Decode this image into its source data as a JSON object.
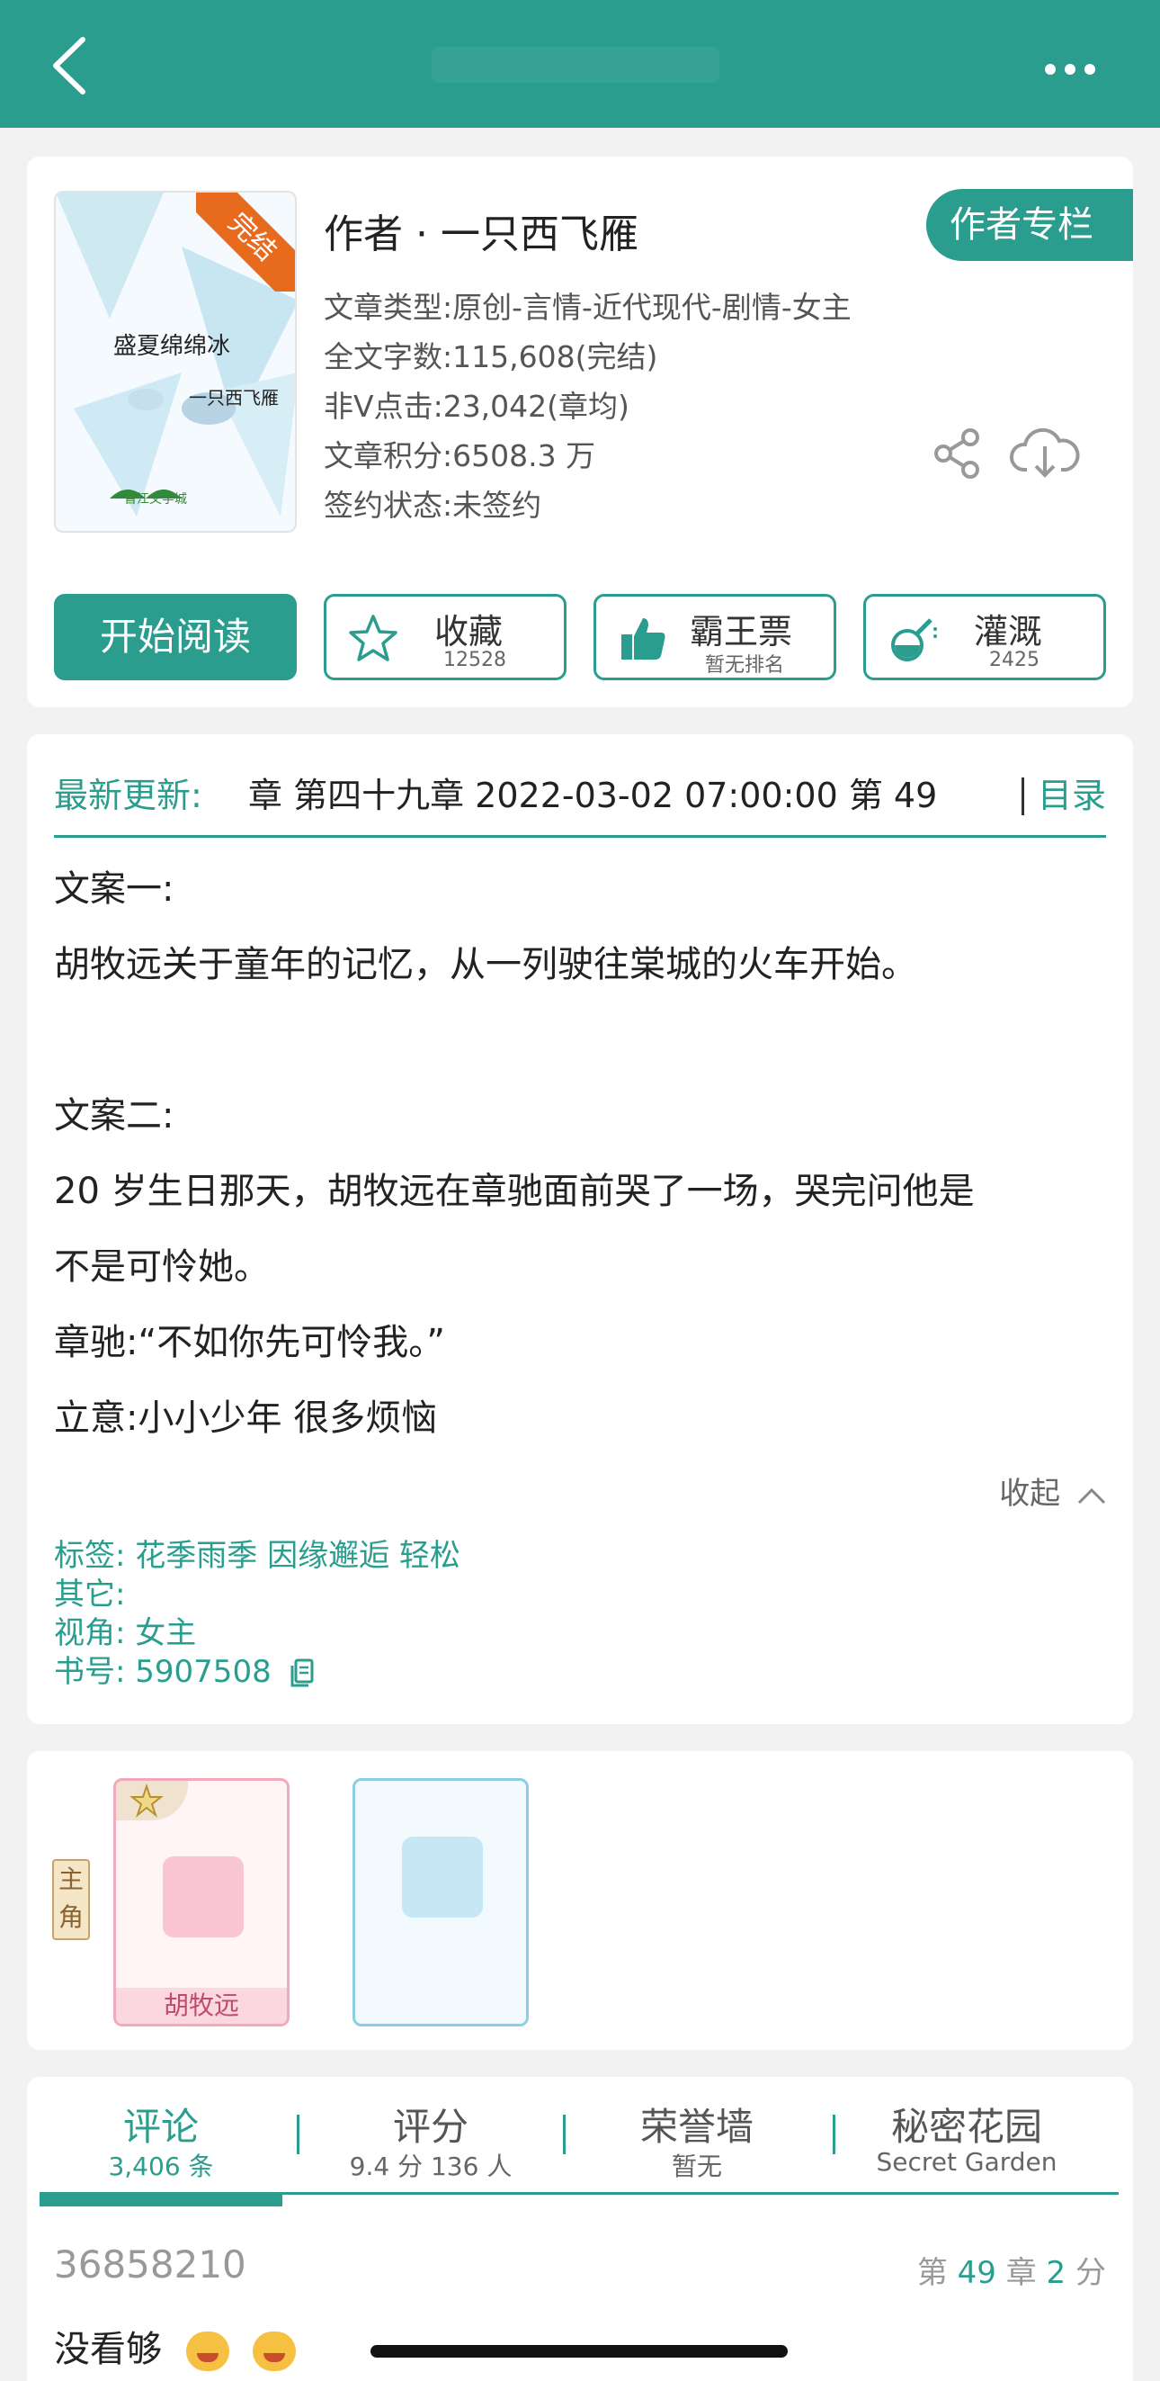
{
  "colors": {
    "accent": "#2a9d8f",
    "ribbon": "#e76a1d"
  },
  "header": {
    "back_icon": "chevron-left-icon",
    "title": "",
    "more_icon": "more-dots-icon"
  },
  "book": {
    "cover_title": "盛夏绵绵冰",
    "cover_author": "一只西飞雁",
    "cover_badge": "完结",
    "cover_publisher": "晋江文学城",
    "author_line": "作者 · 一只西飞雁",
    "author_column_button": "作者专栏",
    "meta": {
      "type": "文章类型:原创-言情-近代现代-剧情-女主",
      "word_count": "全文字数:115,608(完结)",
      "clicks": "非Ⅴ点击:23,042(章均)",
      "score": "文章积分:6508.3 万",
      "sign_status": "签约状态:未签约"
    },
    "actions": {
      "read": "开始阅读",
      "favorite": {
        "label": "收藏",
        "count": "12528"
      },
      "vote": {
        "label": "霸王票",
        "sub": "暂无排名"
      },
      "water": {
        "label": "灌溉",
        "count": "2425"
      }
    }
  },
  "synopsis": {
    "latest_label": "最新更新:",
    "latest_text": "章 第四十九章 2022-03-02 07:00:00  第 49",
    "toc": "目录",
    "lines": [
      "文案一:",
      "胡牧远关于童年的记忆，从一列驶往棠城的火车开始。",
      "",
      "文案二:",
      "20 岁生日那天，胡牧远在章驰面前哭了一场，哭完问他是",
      "不是可怜她。",
      "章驰:“不如你先可怜我。”",
      "立意:小小少年 很多烦恼"
    ],
    "collapse": "收起",
    "tags": {
      "tags_label": "标签:",
      "tags_values": "花季雨季  因缘邂逅  轻松",
      "other_label": "其它:",
      "other_value": "",
      "view_label": "视角:",
      "view_value": "女主",
      "book_no_label": "书号:",
      "book_no_value": "5907508"
    }
  },
  "characters": {
    "role_tag": "主角",
    "items": [
      {
        "name": "胡牧远"
      },
      {
        "name": ""
      }
    ]
  },
  "comments": {
    "tabs": [
      {
        "title": "评论",
        "sub": "3,406 条"
      },
      {
        "title": "评分",
        "sub": "9.4 分 136 人"
      },
      {
        "title": "荣誉墙",
        "sub": "暂无"
      },
      {
        "title": "秘密花园",
        "sub": "Secret Garden"
      }
    ],
    "first": {
      "user": "36858210",
      "chapter_prefix": "第",
      "chapter": "49",
      "chapter_mid": "章",
      "score": "2",
      "score_suffix": "分",
      "text": "没看够"
    }
  }
}
